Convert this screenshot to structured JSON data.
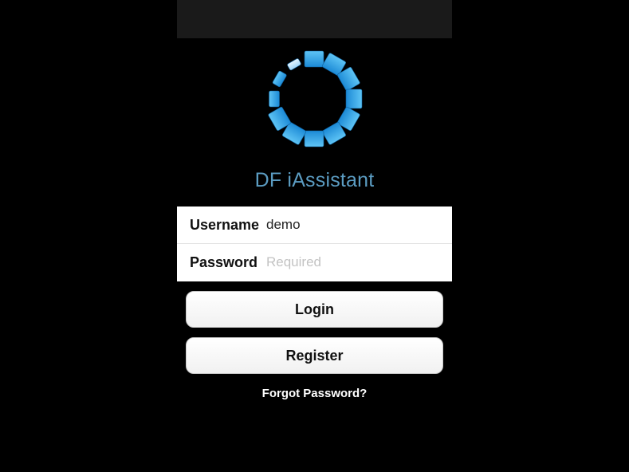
{
  "app": {
    "title": "DF iAssistant",
    "logo_icon": "spinner-logo-icon",
    "accent_color": "#5b9cc2",
    "logo_color": "#2f9de0"
  },
  "login_form": {
    "username_label": "Username",
    "username_value": "demo",
    "password_label": "Password",
    "password_placeholder": "Required"
  },
  "actions": {
    "login_label": "Login",
    "register_label": "Register",
    "forgot_label": "Forgot Password?"
  }
}
